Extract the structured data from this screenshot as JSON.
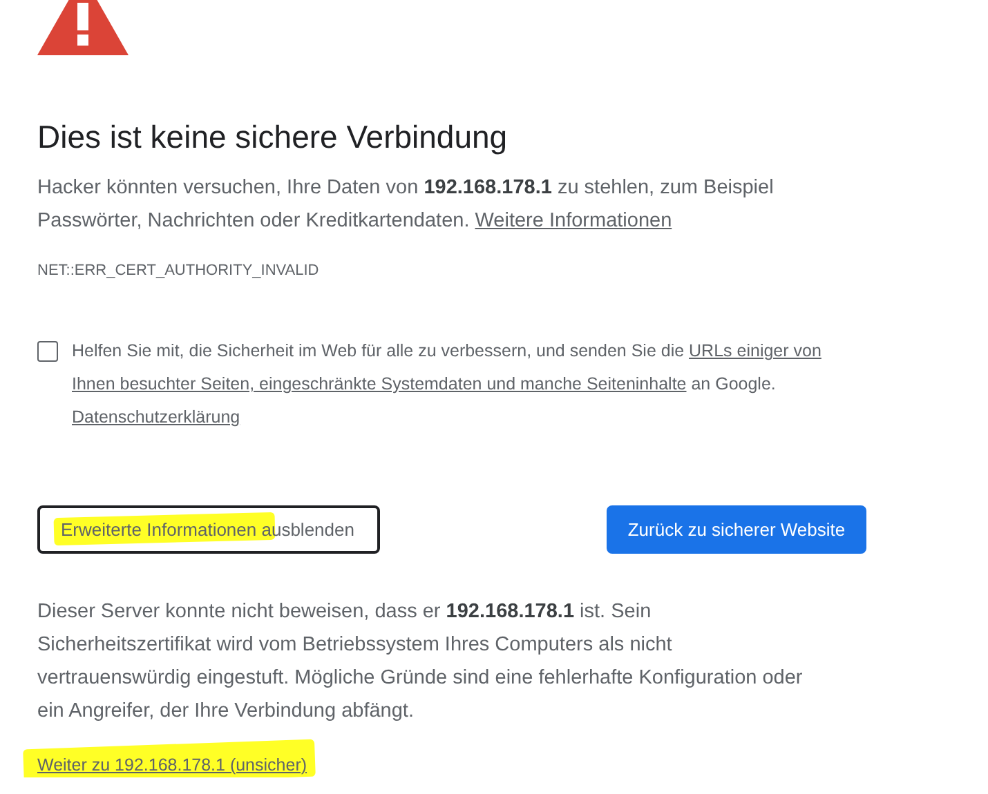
{
  "title": "Dies ist keine sichere Verbindung",
  "intro": [
    {
      "kind": "plain",
      "text": "Hacker könnten versuchen, Ihre Daten von "
    },
    {
      "kind": "bold",
      "text": "192.168.178.1"
    },
    {
      "kind": "plain",
      "text": " zu stehlen, zum Beispiel Passwörter, Nachrichten oder Kreditkartendaten. "
    },
    {
      "kind": "link",
      "text": "Weitere Informationen"
    }
  ],
  "error_code": "NET::ERR_CERT_AUTHORITY_INVALID",
  "consent": {
    "checked": false,
    "text": [
      {
        "kind": "plain",
        "text": "Helfen Sie mit, die Sicherheit im Web für alle zu verbessern, und senden Sie die "
      },
      {
        "kind": "link",
        "text": "URLs einiger von"
      },
      {
        "kind": "link",
        "text": "Ihnen besuchter Seiten, eingeschränkte Systemdaten und manche Seiteninhalte"
      },
      {
        "kind": "plain",
        "text": " an Google. "
      },
      {
        "kind": "link",
        "text": "Datenschutzerklärung"
      }
    ]
  },
  "buttons": [
    {
      "kind": "outline",
      "label": "Erweiterte Informationen ausblenden",
      "highlighted": true
    },
    {
      "kind": "primary",
      "label": "Zurück zu sicherer Website",
      "highlighted": false
    }
  ],
  "details": [
    {
      "kind": "plain",
      "text": "Dieser Server konnte nicht beweisen, dass er "
    },
    {
      "kind": "bold",
      "text": "192.168.178.1"
    },
    {
      "kind": "plain",
      "text": " ist. Sein Sicherheitszertifikat wird vom Betriebssystem Ihres Computers als nicht vertrauenswürdig eingestuft. Mögliche Gründe sind eine fehlerhafte Konfiguration oder ein Angreifer, der Ihre Verbindung abfängt."
    }
  ],
  "proceed_link": {
    "text": "Weiter zu 192.168.178.1 (unsicher)",
    "highlighted": true
  }
}
